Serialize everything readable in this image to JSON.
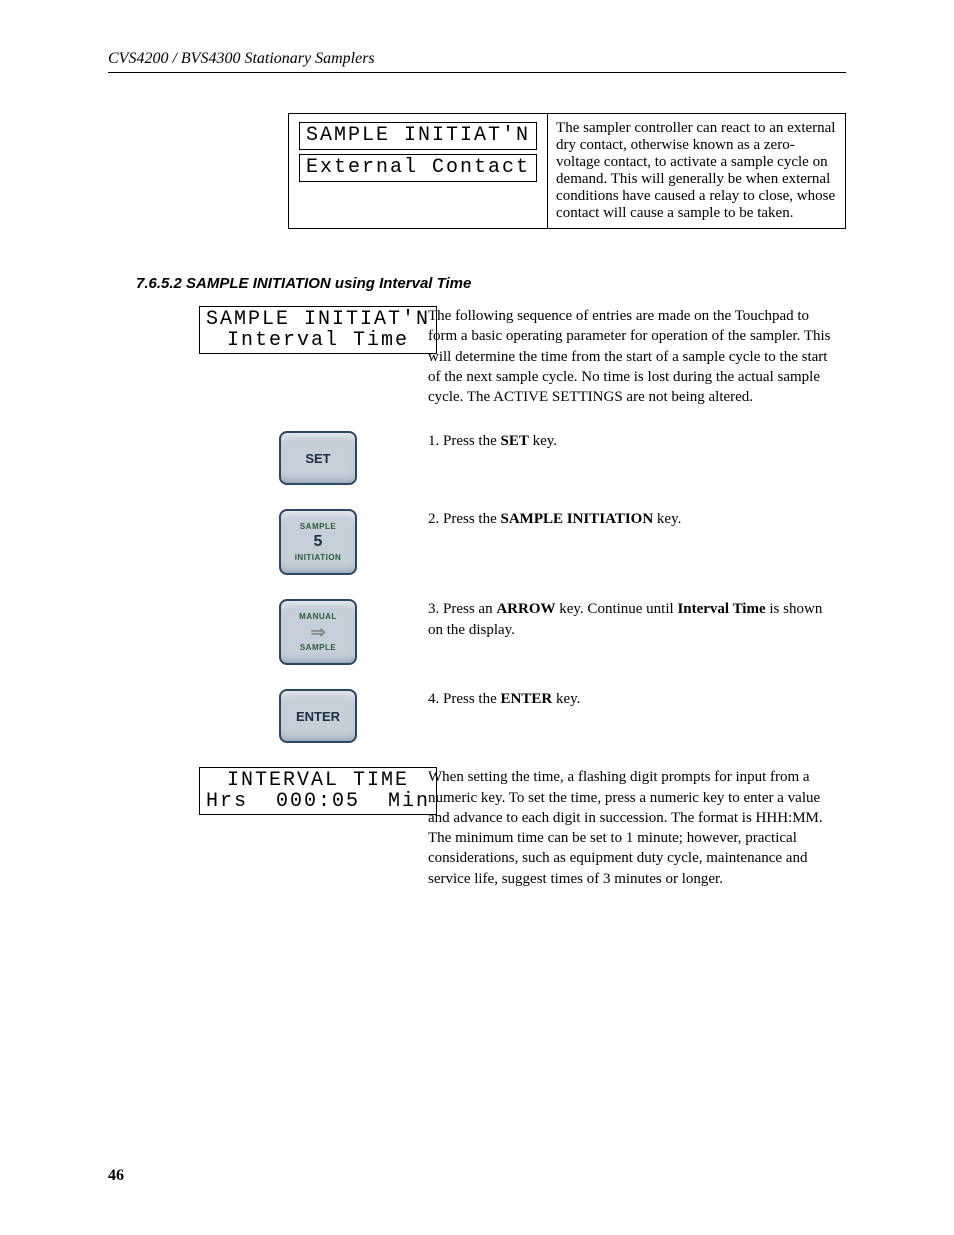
{
  "header": "CVS4200 / BVS4300 Stationary Samplers",
  "table1": {
    "lcd": {
      "line1": "SAMPLE INITIAT'N",
      "line2": "External Contact"
    },
    "desc": "The sampler controller can react to an external dry contact, otherwise known as a zero-voltage contact, to activate a sample cycle on demand. This will generally be when external conditions have caused a relay to close, whose contact will cause a sample to be taken."
  },
  "section_heading": "7.6.5.2  SAMPLE INITIATION using Interval Time",
  "intro": {
    "lcd": {
      "line1": "SAMPLE INITIAT'N",
      "line2": "Interval Time"
    },
    "desc": "The following sequence of entries are made on the Touchpad to form a basic operating parameter for operation of the sampler. This will determine the time from the start of a sample cycle to the start of the next sample cycle. No time is lost during the actual sample cycle. The ACTIVE SETTINGS are not being altered."
  },
  "steps": [
    {
      "key": {
        "type": "single",
        "label": "SET"
      },
      "text_before": "1. Press the ",
      "bold": "SET",
      "text_after": " key."
    },
    {
      "key": {
        "type": "numbered",
        "top": "SAMPLE",
        "num": "5",
        "bottom": "INITIATION"
      },
      "text_before": "2. Press the ",
      "bold": "SAMPLE INITIATION",
      "text_after": " key."
    },
    {
      "key": {
        "type": "arrow",
        "top": "MANUAL",
        "bottom": "SAMPLE"
      },
      "text_before": "3. Press an ",
      "bold": "ARROW",
      "text_after": " key. Continue until ",
      "bold2": "Interval Time",
      "text_after2": " is shown on the display."
    },
    {
      "key": {
        "type": "single",
        "label": "ENTER"
      },
      "text_before": "4. Press the ",
      "bold": "ENTER",
      "text_after": " key."
    }
  ],
  "interval": {
    "lcd": {
      "line1": "INTERVAL TIME",
      "line2": "Hrs  000:05  Min"
    },
    "desc": "When setting the time, a flashing digit prompts for input from a numeric key. To set the time, press a numeric key to enter a value and advance to each digit in succession.  The format is HHH:MM. The minimum time can be set to 1 minute; however, practical considerations, such as equipment duty cycle, maintenance and service life, suggest times of 3 minutes or longer."
  },
  "page_number": "46"
}
